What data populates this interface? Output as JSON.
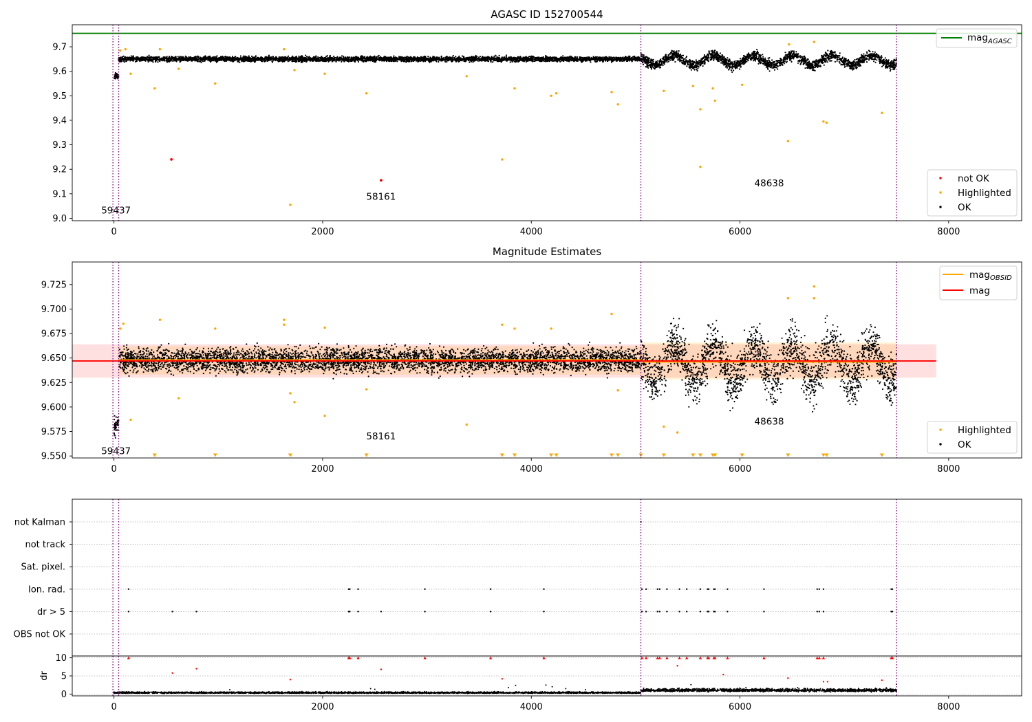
{
  "figure": {
    "title": "AGASC ID 152700544",
    "colors": {
      "ok": "#000000",
      "highlighted": "#ffa500",
      "not_ok": "#ff0000",
      "mag_agasc": "#008000",
      "mag_obsid": "#ffa500",
      "mag": "#ff0000",
      "obsid_boundary": "#800080"
    }
  },
  "chart_data": [
    {
      "type": "scatter",
      "title": "AGASC ID 152700544",
      "xlim": [
        -400,
        8700
      ],
      "ylim": [
        8.99,
        9.79
      ],
      "x_ticks": [
        "0",
        "2000",
        "4000",
        "6000",
        "8000"
      ],
      "y_ticks": [
        "9.0",
        "9.1",
        "9.2",
        "9.3",
        "9.4",
        "9.5",
        "9.6",
        "9.7"
      ],
      "obsid_boundaries": [
        -10,
        45,
        5050,
        7500
      ],
      "obsid_labels": [
        {
          "text": "59437",
          "x": 20,
          "y": 9.02
        },
        {
          "text": "58161",
          "x": 2560,
          "y": 9.075
        },
        {
          "text": "48638",
          "x": 6280,
          "y": 9.13
        }
      ],
      "hlines": [
        {
          "y": 9.755,
          "name": "mag_agasc",
          "label": "mag",
          "sub": "AGASC"
        }
      ],
      "ok_segments": [
        {
          "x": [
            0,
            45
          ],
          "y": 9.58,
          "spread": 0.012
        },
        {
          "x": [
            45,
            5050
          ],
          "y": 9.65,
          "spread": 0.01
        },
        {
          "x": [
            5050,
            7500
          ],
          "y": 9.645,
          "spread": 0.02
        }
      ],
      "highlighted": [
        {
          "x": 60,
          "y": 9.685
        },
        {
          "x": 110,
          "y": 9.69
        },
        {
          "x": 160,
          "y": 9.59
        },
        {
          "x": 390,
          "y": 9.53
        },
        {
          "x": 440,
          "y": 9.69
        },
        {
          "x": 620,
          "y": 9.61
        },
        {
          "x": 970,
          "y": 9.55
        },
        {
          "x": 1630,
          "y": 9.69
        },
        {
          "x": 1690,
          "y": 9.055
        },
        {
          "x": 1730,
          "y": 9.605
        },
        {
          "x": 2020,
          "y": 9.59
        },
        {
          "x": 2420,
          "y": 9.51
        },
        {
          "x": 3380,
          "y": 9.58
        },
        {
          "x": 3720,
          "y": 9.24
        },
        {
          "x": 3840,
          "y": 9.53
        },
        {
          "x": 4190,
          "y": 9.5
        },
        {
          "x": 4240,
          "y": 9.51
        },
        {
          "x": 4770,
          "y": 9.515
        },
        {
          "x": 4830,
          "y": 9.465
        },
        {
          "x": 5270,
          "y": 9.52
        },
        {
          "x": 5550,
          "y": 9.54
        },
        {
          "x": 5620,
          "y": 9.445
        },
        {
          "x": 5620,
          "y": 9.21
        },
        {
          "x": 5740,
          "y": 9.53
        },
        {
          "x": 5760,
          "y": 9.48
        },
        {
          "x": 6020,
          "y": 9.545
        },
        {
          "x": 6460,
          "y": 9.315
        },
        {
          "x": 6800,
          "y": 9.395
        },
        {
          "x": 6830,
          "y": 9.39
        },
        {
          "x": 7360,
          "y": 9.43
        },
        {
          "x": 6710,
          "y": 9.72
        },
        {
          "x": 6470,
          "y": 9.71
        }
      ],
      "not_ok": [
        {
          "x": 550,
          "y": 9.24
        },
        {
          "x": 2560,
          "y": 9.155
        }
      ],
      "legend": [
        {
          "name": "mag_agasc",
          "label": "mag",
          "sub": "AGASC",
          "place": "top-right"
        },
        {
          "name": "not_ok",
          "label": "not OK",
          "place": "bottom-right"
        },
        {
          "name": "highlighted",
          "label": "Highlighted",
          "place": "bottom-right"
        },
        {
          "name": "ok",
          "label": "OK",
          "place": "bottom-right"
        }
      ]
    },
    {
      "type": "scatter",
      "title": "Magnitude Estimates",
      "xlim": [
        -400,
        8700
      ],
      "ylim": [
        9.548,
        9.748
      ],
      "x_ticks": [
        "0",
        "2000",
        "4000",
        "6000",
        "8000"
      ],
      "y_ticks": [
        "9.550",
        "9.575",
        "9.600",
        "9.625",
        "9.650",
        "9.675",
        "9.700",
        "9.725"
      ],
      "obsid_boundaries": [
        -10,
        45,
        5050,
        7500
      ],
      "obsid_labels": [
        {
          "text": "59437",
          "x": 20,
          "y": 9.552
        },
        {
          "text": "58161",
          "x": 2560,
          "y": 9.567
        },
        {
          "text": "48638",
          "x": 6280,
          "y": 9.582
        }
      ],
      "mag_band": {
        "x": [
          -400,
          7880
        ],
        "y": [
          9.63,
          9.664
        ]
      },
      "mag_line": {
        "x": [
          -400,
          7880
        ],
        "y": 9.647
      },
      "obsid_bands": [
        {
          "x": [
            45,
            5050
          ],
          "y": [
            9.633,
            9.662
          ],
          "mean": 9.648
        },
        {
          "x": [
            5050,
            7500
          ],
          "y": [
            9.628,
            9.666
          ],
          "mean": 9.646
        }
      ],
      "ok_segments": [
        {
          "x": [
            0,
            45
          ],
          "y": 9.58,
          "spread": 0.01
        },
        {
          "x": [
            45,
            5050
          ],
          "y": 9.648,
          "spread": 0.012
        },
        {
          "x": [
            5050,
            7500
          ],
          "y": 9.645,
          "spread": 0.025
        }
      ],
      "highlighted": [
        {
          "x": 60,
          "y": 9.68
        },
        {
          "x": 90,
          "y": 9.685
        },
        {
          "x": 160,
          "y": 9.587
        },
        {
          "x": 440,
          "y": 9.689
        },
        {
          "x": 620,
          "y": 9.609
        },
        {
          "x": 970,
          "y": 9.68
        },
        {
          "x": 1630,
          "y": 9.689
        },
        {
          "x": 1630,
          "y": 9.684
        },
        {
          "x": 1690,
          "y": 9.614
        },
        {
          "x": 1730,
          "y": 9.605
        },
        {
          "x": 2020,
          "y": 9.681
        },
        {
          "x": 2020,
          "y": 9.591
        },
        {
          "x": 2420,
          "y": 9.618
        },
        {
          "x": 3380,
          "y": 9.582
        },
        {
          "x": 3720,
          "y": 9.684
        },
        {
          "x": 3840,
          "y": 9.68
        },
        {
          "x": 4190,
          "y": 9.68
        },
        {
          "x": 4770,
          "y": 9.695
        },
        {
          "x": 4830,
          "y": 9.617
        },
        {
          "x": 5270,
          "y": 9.58
        },
        {
          "x": 5400,
          "y": 9.574
        },
        {
          "x": 6460,
          "y": 9.711
        },
        {
          "x": 6710,
          "y": 9.723
        },
        {
          "x": 6710,
          "y": 9.711
        }
      ],
      "off_scale_x": [
        390,
        970,
        1690,
        2420,
        3720,
        3840,
        4190,
        4240,
        4770,
        4830,
        5050,
        5270,
        5550,
        5620,
        5740,
        5760,
        6020,
        6460,
        6800,
        6830,
        7360
      ],
      "legend": [
        {
          "name": "mag_obsid",
          "label": "mag",
          "sub": "OBSID",
          "place": "top-right"
        },
        {
          "name": "mag",
          "label": "mag",
          "place": "top-right"
        },
        {
          "name": "highlighted",
          "label": "Highlighted",
          "place": "bottom-right"
        },
        {
          "name": "ok",
          "label": "OK",
          "place": "bottom-right"
        }
      ]
    },
    {
      "type": "scatter",
      "title": "",
      "xlim": [
        -400,
        8700
      ],
      "x_ticks": [
        "0",
        "2000",
        "4000",
        "6000",
        "8000"
      ],
      "categories": [
        "not Kalman",
        "not track",
        "Sat. pixel.",
        "Ion. rad.",
        "dr > 5",
        "OBS not OK"
      ],
      "obsid_boundaries": [
        -10,
        45,
        5050,
        7500
      ],
      "flags": {
        "not Kalman": [
          5050
        ],
        "not track": [],
        "Sat. pixel.": [],
        "Ion. rad.": [
          140,
          2250,
          2260,
          2340,
          2980,
          3610,
          4120,
          5060,
          5100,
          5210,
          5230,
          5300,
          5420,
          5490,
          5620,
          5690,
          5700,
          5750,
          5760,
          5880,
          6230,
          6740,
          6760,
          6800,
          7450,
          7460
        ],
        "dr > 5": [
          140,
          560,
          790,
          2250,
          2260,
          2340,
          2560,
          2980,
          3610,
          4120,
          5060,
          5100,
          5210,
          5230,
          5300,
          5420,
          5490,
          5620,
          5690,
          5700,
          5750,
          5760,
          5880,
          6230,
          6740,
          6760,
          6800,
          7450,
          7460
        ],
        "OBS not OK": []
      }
    },
    {
      "type": "scatter",
      "title": "",
      "ylabel": "dr",
      "xlim": [
        -400,
        8700
      ],
      "ylim": [
        -0.5,
        10.5
      ],
      "x_ticks": [
        "0",
        "2000",
        "4000",
        "6000",
        "8000"
      ],
      "y_ticks": [
        "0",
        "5",
        "10"
      ],
      "obsid_boundaries": [
        -10,
        45,
        5050,
        7500
      ],
      "ok_segments": [
        {
          "x": [
            0,
            5050
          ],
          "y": 0.35,
          "spread": 0.25
        },
        {
          "x": [
            5050,
            7500
          ],
          "y": 1.0,
          "spread": 0.5
        }
      ],
      "ok_extra": [
        {
          "x": 1110,
          "y": 1.2
        },
        {
          "x": 2460,
          "y": 1.5
        },
        {
          "x": 2500,
          "y": 1.3
        },
        {
          "x": 3780,
          "y": 1.8
        },
        {
          "x": 3850,
          "y": 2.4
        },
        {
          "x": 4140,
          "y": 2.5
        },
        {
          "x": 4200,
          "y": 2.0
        },
        {
          "x": 4330,
          "y": 1.5
        },
        {
          "x": 4520,
          "y": 1.2
        },
        {
          "x": 5530,
          "y": 2.6
        },
        {
          "x": 7500,
          "y": 2.7
        }
      ],
      "not_ok_pts": [
        {
          "x": 560,
          "y": 5.8
        },
        {
          "x": 790,
          "y": 7.0
        },
        {
          "x": 1690,
          "y": 4.0
        },
        {
          "x": 2560,
          "y": 6.8
        },
        {
          "x": 3720,
          "y": 4.2
        },
        {
          "x": 5400,
          "y": 7.8
        },
        {
          "x": 5840,
          "y": 5.4
        },
        {
          "x": 6460,
          "y": 4.4
        },
        {
          "x": 6800,
          "y": 3.4
        },
        {
          "x": 6840,
          "y": 3.4
        },
        {
          "x": 7360,
          "y": 3.8
        }
      ],
      "clipped_x": [
        140,
        2250,
        2260,
        2340,
        2980,
        3610,
        4120,
        5060,
        5100,
        5210,
        5230,
        5300,
        5420,
        5490,
        5620,
        5690,
        5700,
        5750,
        5760,
        5880,
        6230,
        6740,
        6760,
        6800,
        7450,
        7460
      ]
    }
  ]
}
